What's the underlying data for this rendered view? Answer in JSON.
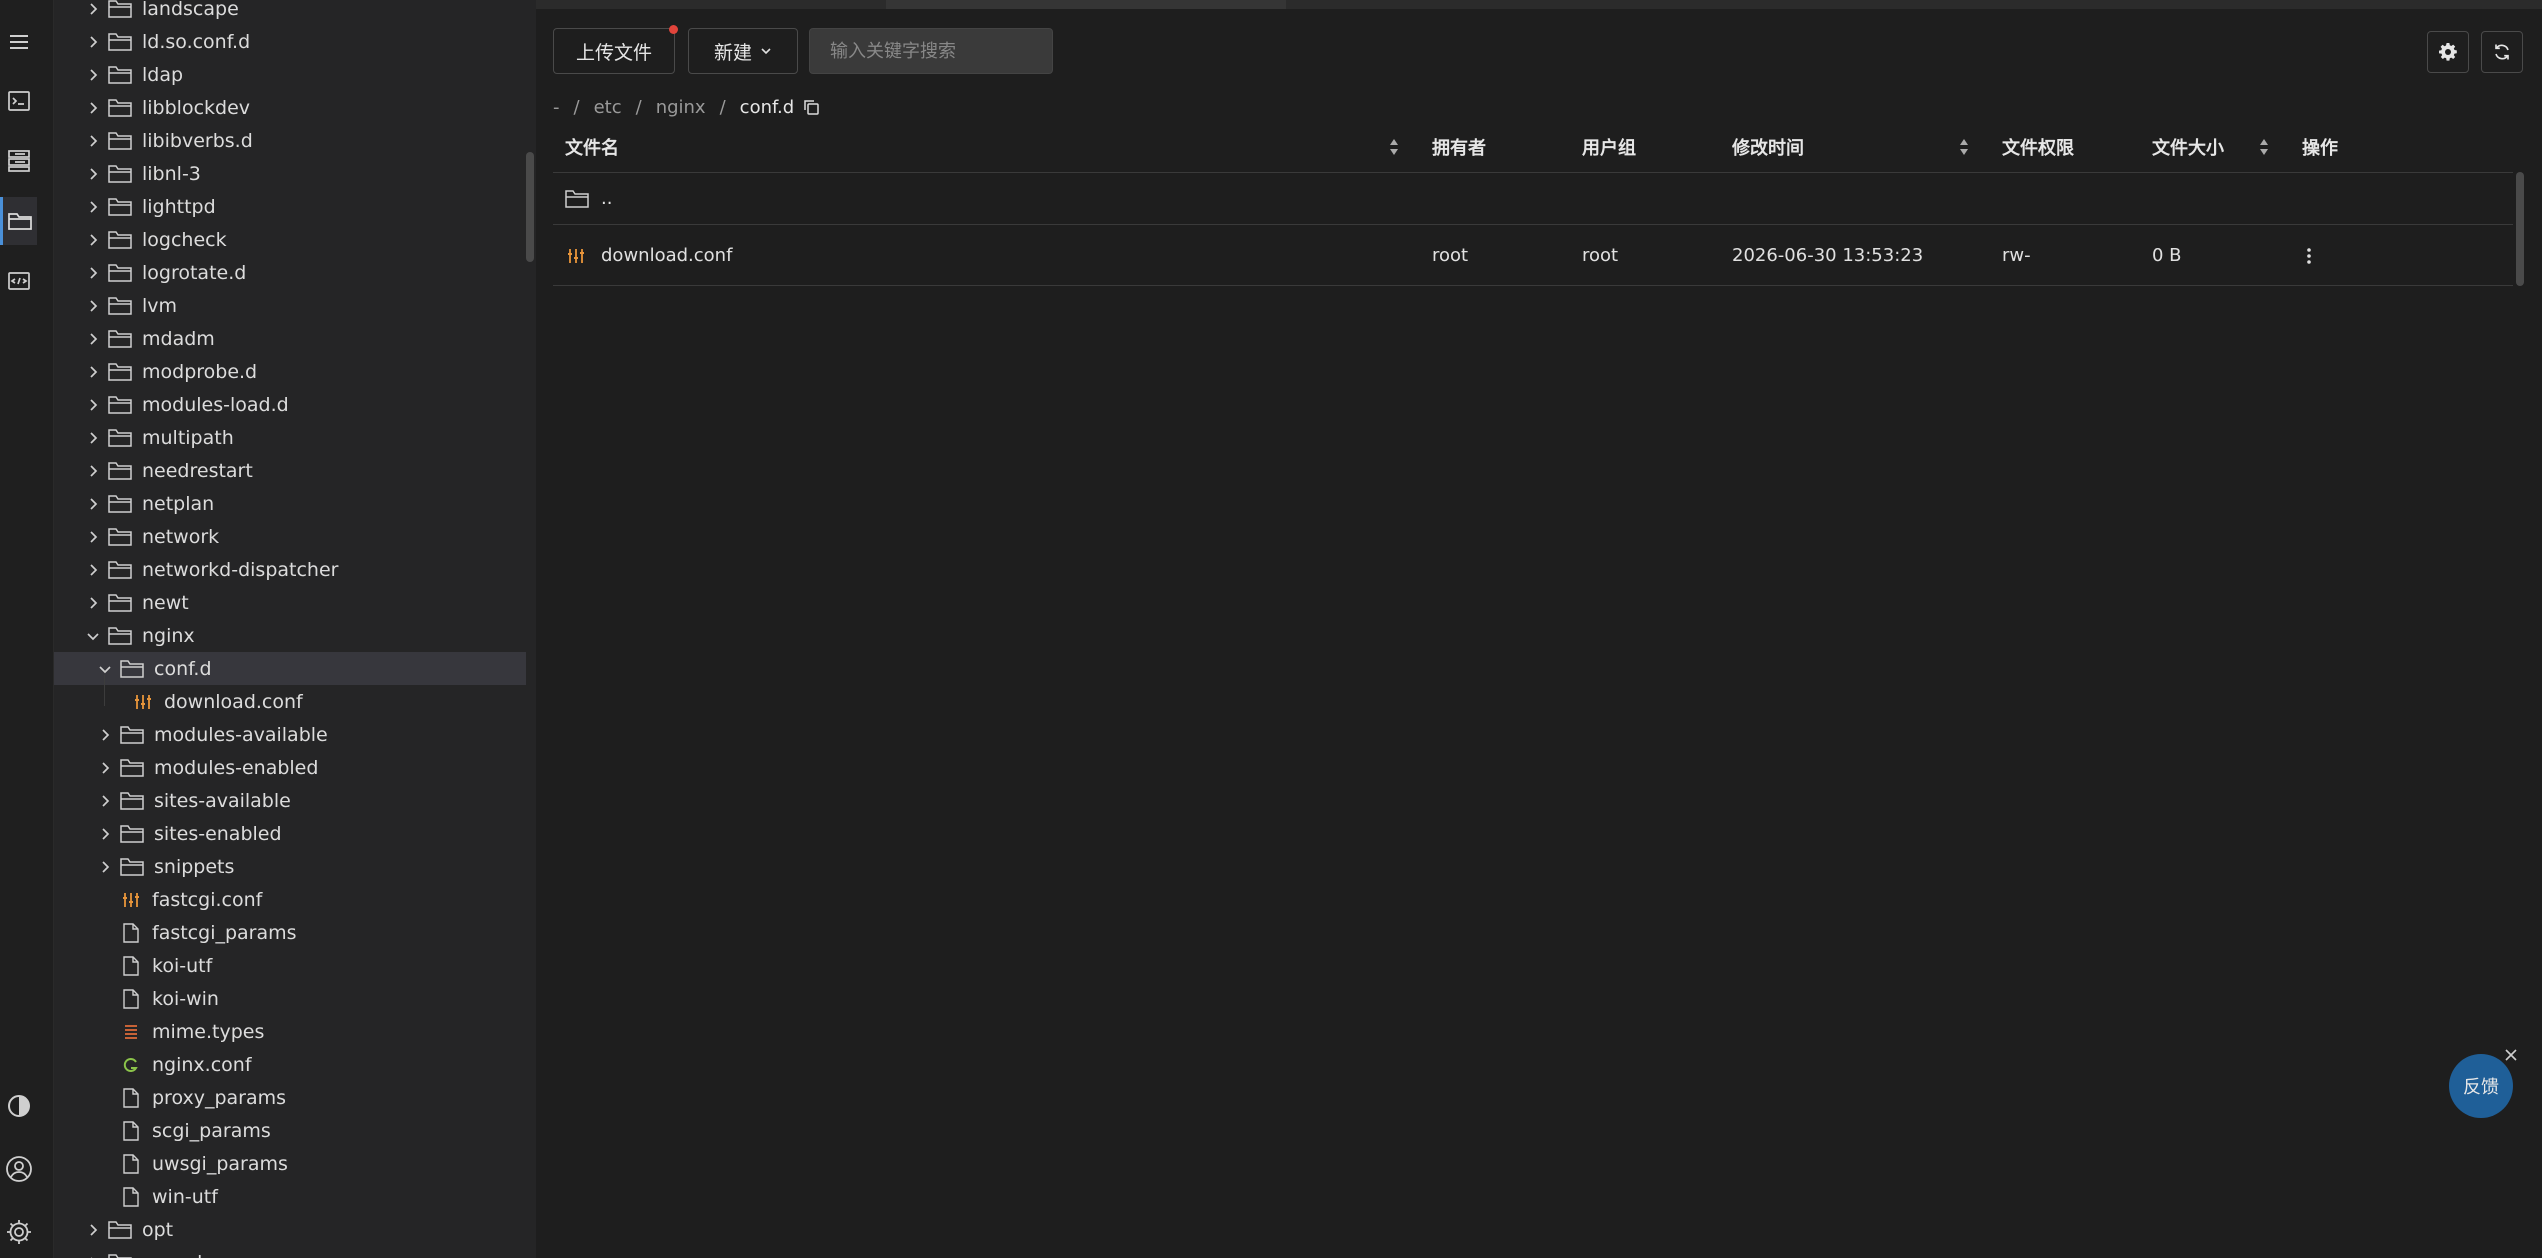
{
  "activity_bar": {
    "items": [
      {
        "name": "menu-icon"
      },
      {
        "name": "terminal-icon"
      },
      {
        "name": "servers-icon"
      },
      {
        "name": "folder-icon",
        "active": true
      },
      {
        "name": "code-file-icon"
      },
      {
        "name": "theme-toggle-icon"
      },
      {
        "name": "user-icon"
      },
      {
        "name": "gear-icon"
      }
    ]
  },
  "tree": {
    "items": [
      {
        "label": "landscape",
        "type": "folder",
        "level": 0,
        "expanded": false
      },
      {
        "label": "ld.so.conf.d",
        "type": "folder",
        "level": 0,
        "expanded": false
      },
      {
        "label": "ldap",
        "type": "folder",
        "level": 0,
        "expanded": false
      },
      {
        "label": "libblockdev",
        "type": "folder",
        "level": 0,
        "expanded": false
      },
      {
        "label": "libibverbs.d",
        "type": "folder",
        "level": 0,
        "expanded": false
      },
      {
        "label": "libnl-3",
        "type": "folder",
        "level": 0,
        "expanded": false
      },
      {
        "label": "lighttpd",
        "type": "folder",
        "level": 0,
        "expanded": false
      },
      {
        "label": "logcheck",
        "type": "folder",
        "level": 0,
        "expanded": false
      },
      {
        "label": "logrotate.d",
        "type": "folder",
        "level": 0,
        "expanded": false
      },
      {
        "label": "lvm",
        "type": "folder",
        "level": 0,
        "expanded": false
      },
      {
        "label": "mdadm",
        "type": "folder",
        "level": 0,
        "expanded": false
      },
      {
        "label": "modprobe.d",
        "type": "folder",
        "level": 0,
        "expanded": false
      },
      {
        "label": "modules-load.d",
        "type": "folder",
        "level": 0,
        "expanded": false
      },
      {
        "label": "multipath",
        "type": "folder",
        "level": 0,
        "expanded": false
      },
      {
        "label": "needrestart",
        "type": "folder",
        "level": 0,
        "expanded": false
      },
      {
        "label": "netplan",
        "type": "folder",
        "level": 0,
        "expanded": false
      },
      {
        "label": "network",
        "type": "folder",
        "level": 0,
        "expanded": false
      },
      {
        "label": "networkd-dispatcher",
        "type": "folder",
        "level": 0,
        "expanded": false
      },
      {
        "label": "newt",
        "type": "folder",
        "level": 0,
        "expanded": false
      },
      {
        "label": "nginx",
        "type": "folder",
        "level": 0,
        "expanded": true
      },
      {
        "label": "conf.d",
        "type": "folder",
        "level": 1,
        "expanded": true,
        "selected": true
      },
      {
        "label": "download.conf",
        "type": "conf",
        "level": 2
      },
      {
        "label": "modules-available",
        "type": "folder",
        "level": 1,
        "expanded": false
      },
      {
        "label": "modules-enabled",
        "type": "folder",
        "level": 1,
        "expanded": false
      },
      {
        "label": "sites-available",
        "type": "folder",
        "level": 1,
        "expanded": false
      },
      {
        "label": "sites-enabled",
        "type": "folder",
        "level": 1,
        "expanded": false
      },
      {
        "label": "snippets",
        "type": "folder",
        "level": 1,
        "expanded": false
      },
      {
        "label": "fastcgi.conf",
        "type": "conf",
        "level": 1
      },
      {
        "label": "fastcgi_params",
        "type": "file",
        "level": 1
      },
      {
        "label": "koi-utf",
        "type": "file",
        "level": 1
      },
      {
        "label": "koi-win",
        "type": "file",
        "level": 1
      },
      {
        "label": "mime.types",
        "type": "types",
        "level": 1
      },
      {
        "label": "nginx.conf",
        "type": "nginx",
        "level": 1
      },
      {
        "label": "proxy_params",
        "type": "file",
        "level": 1
      },
      {
        "label": "scgi_params",
        "type": "file",
        "level": 1
      },
      {
        "label": "uwsgi_params",
        "type": "file",
        "level": 1
      },
      {
        "label": "win-utf",
        "type": "file",
        "level": 1
      },
      {
        "label": "opt",
        "type": "folder",
        "level": 0,
        "expanded": false
      },
      {
        "label": "pam.d",
        "type": "folder",
        "level": 0,
        "expanded": false
      }
    ]
  },
  "toolbar": {
    "upload_label": "上传文件",
    "new_label": "新建",
    "search_placeholder": "输入关键字搜索"
  },
  "breadcrumb": {
    "items": [
      "-",
      "etc",
      "nginx",
      "conf.d"
    ],
    "separator": "/"
  },
  "table": {
    "columns": {
      "name": "文件名",
      "owner": "拥有者",
      "group": "用户组",
      "mtime": "修改时间",
      "perm": "文件权限",
      "size": "文件大小",
      "actions": "操作"
    },
    "parent_label": "..",
    "rows": [
      {
        "name": "download.conf",
        "owner": "root",
        "group": "root",
        "mtime": "2026-06-30 13:53:23",
        "perm": "rw-",
        "size": "0 B"
      }
    ]
  },
  "feedback": {
    "label": "反馈"
  },
  "colors": {
    "accent": "#4a90d9",
    "conf_icon": "#e8953a",
    "nginx_icon": "#8bc34a",
    "types_icon": "#e06c3a",
    "feedback_bg": "#1f5f98"
  }
}
